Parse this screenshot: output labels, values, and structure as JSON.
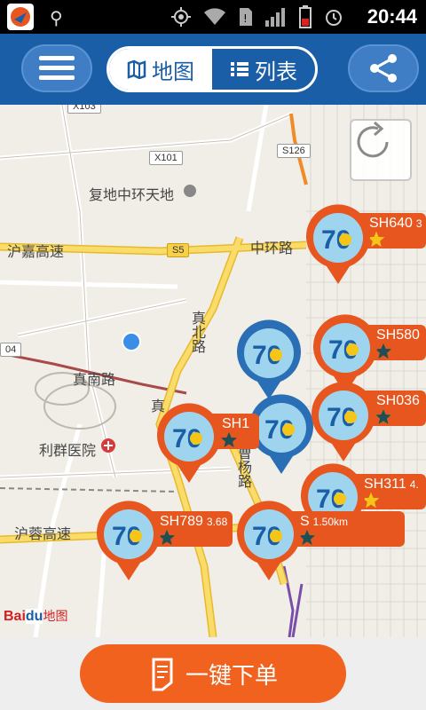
{
  "status_bar": {
    "time": "20:44"
  },
  "toolbar": {
    "tabs": [
      {
        "label": "地图",
        "icon": "map-icon",
        "active": true
      },
      {
        "label": "列表",
        "icon": "list-icon",
        "active": false
      }
    ]
  },
  "map": {
    "labels": {
      "fudi": "复地中环天地",
      "hujia": "沪嘉高速",
      "zhonghuan": "中环路",
      "zhenbei": "真北路",
      "zhennan": "真南路",
      "zhen2": "真",
      "liqun": "利群医院",
      "hurong": "沪蓉高速",
      "caoyang": "曹杨路",
      "x101": "X101",
      "s126": "S126",
      "s5": "S5",
      "x103": "X103",
      "s04": "04"
    },
    "logo": {
      "text_bai": "Bai",
      "text_du": "du",
      "text_map": "地图"
    },
    "vehicles": [
      {
        "plate": "SH640",
        "dist": "3",
        "stars": [
          1,
          1,
          1
        ]
      },
      {
        "plate": "SH580",
        "dist": "",
        "stars": [
          1,
          0,
          0
        ]
      },
      {
        "plate": "SH036",
        "dist": "",
        "stars": [
          1,
          1,
          0
        ]
      },
      {
        "plate": "SH1",
        "dist": "",
        "stars": [
          1,
          0,
          0
        ]
      },
      {
        "plate": "SH311",
        "dist": "4.",
        "stars": [
          1,
          1,
          1
        ]
      },
      {
        "plate": "SH789",
        "dist": "3.68",
        "stars": [
          1,
          0,
          0
        ]
      },
      {
        "plate": "S",
        "dist": "1.50km",
        "stars": [
          1,
          1,
          1,
          0,
          0
        ]
      }
    ]
  },
  "bottom": {
    "order_label": "一键下单"
  },
  "colors": {
    "accent_blue": "#1a5ea8",
    "accent_orange": "#e7561f",
    "star_yellow": "#f5c518"
  }
}
